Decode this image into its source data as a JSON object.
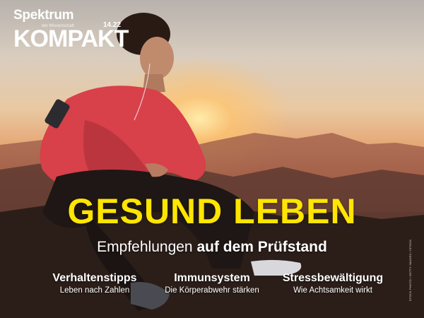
{
  "brand": {
    "name": "Spektrum",
    "subtitle": "der Wissenschaft"
  },
  "series": {
    "title": "KOMPAKT",
    "issue": "14.22"
  },
  "headline": "GESUND LEBEN",
  "subheadline": {
    "regular": "Empfehlungen",
    "bold": "auf dem Prüfstand"
  },
  "topics": [
    {
      "title": "Verhaltenstipps",
      "subtitle": "Leben nach Zahlen"
    },
    {
      "title": "Immunsystem",
      "subtitle": "Die Körperabwehr stärken"
    },
    {
      "title": "Stressbewältigung",
      "subtitle": "Wie Achtsamkeit wirkt"
    }
  ],
  "photo_credit": "STOCK PHOTO / GETTY IMAGES / ISTOCK",
  "colors": {
    "headline": "#ffe500",
    "text": "#ffffff",
    "jacket": "#d8404a"
  }
}
